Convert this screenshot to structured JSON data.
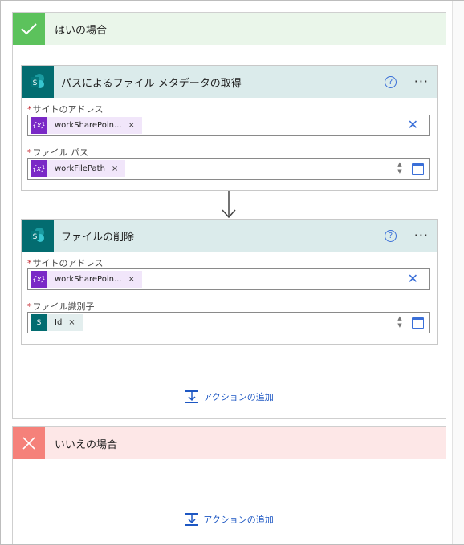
{
  "yes_branch": {
    "title": "はいの場合",
    "icon": "check-icon",
    "color": "#5cc25c",
    "add_action": "アクションの追加"
  },
  "no_branch": {
    "title": "いいえの場合",
    "icon": "close-icon",
    "color": "#f5817a",
    "add_action": "アクションの追加"
  },
  "card1": {
    "title": "パスによるファイル メタデータの取得",
    "fields": [
      {
        "label": "サイトのアドレス",
        "required": "*",
        "token": "workSharePoin...",
        "token_icon": "{x}",
        "remove": "×"
      },
      {
        "label": "ファイル パス",
        "required": "*",
        "token": "workFilePath",
        "token_icon": "{x}",
        "remove": "×"
      }
    ]
  },
  "card2": {
    "title": "ファイルの削除",
    "fields": [
      {
        "label": "サイトのアドレス",
        "required": "*",
        "token": "workSharePoin...",
        "token_icon": "{x}",
        "remove": "×"
      },
      {
        "label": "ファイル識別子",
        "required": "*",
        "token": "Id",
        "token_icon": "S",
        "remove": "×"
      }
    ]
  },
  "common": {
    "help": "?",
    "more": "···",
    "clear": "✕",
    "sp_letter": "S",
    "step_up": "▲",
    "step_down": "▼"
  }
}
